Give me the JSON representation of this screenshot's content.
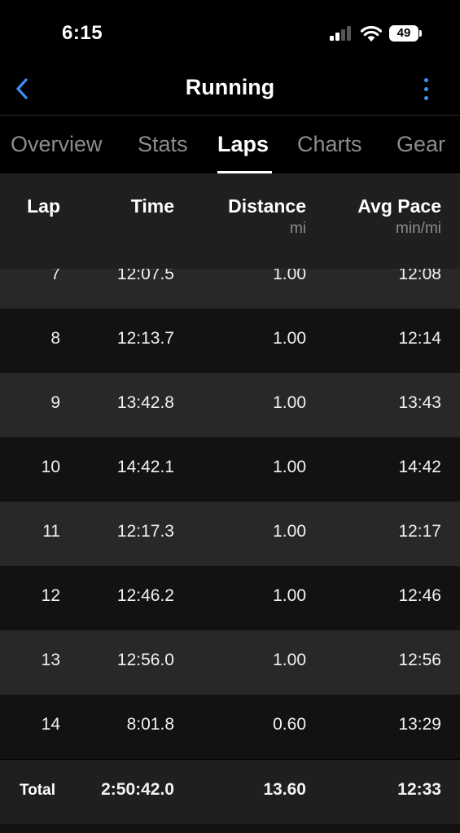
{
  "status_bar": {
    "time": "6:15",
    "battery": "49"
  },
  "nav": {
    "title": "Running",
    "back_icon": "chevron-left-icon",
    "menu_icon": "vertical-ellipsis-icon"
  },
  "tabs": [
    {
      "label": "Overview",
      "active": false
    },
    {
      "label": "Stats",
      "active": false
    },
    {
      "label": "Laps",
      "active": true
    },
    {
      "label": "Charts",
      "active": false
    },
    {
      "label": "Gear",
      "active": false
    }
  ],
  "table": {
    "columns": [
      {
        "label": "Lap",
        "unit": ""
      },
      {
        "label": "Time",
        "unit": ""
      },
      {
        "label": "Distance",
        "unit": "mi"
      },
      {
        "label": "Avg Pace",
        "unit": "min/mi"
      }
    ],
    "rows": [
      {
        "lap": "7",
        "time": "12:07.5",
        "distance": "1.00",
        "pace": "12:08"
      },
      {
        "lap": "8",
        "time": "12:13.7",
        "distance": "1.00",
        "pace": "12:14"
      },
      {
        "lap": "9",
        "time": "13:42.8",
        "distance": "1.00",
        "pace": "13:43"
      },
      {
        "lap": "10",
        "time": "14:42.1",
        "distance": "1.00",
        "pace": "14:42"
      },
      {
        "lap": "11",
        "time": "12:17.3",
        "distance": "1.00",
        "pace": "12:17"
      },
      {
        "lap": "12",
        "time": "12:46.2",
        "distance": "1.00",
        "pace": "12:46"
      },
      {
        "lap": "13",
        "time": "12:56.0",
        "distance": "1.00",
        "pace": "12:56"
      },
      {
        "lap": "14",
        "time": "8:01.8",
        "distance": "0.60",
        "pace": "13:29"
      }
    ],
    "total": {
      "label": "Total",
      "time": "2:50:42.0",
      "distance": "13.60",
      "pace": "12:33"
    }
  },
  "colors": {
    "accent": "#3b8ff5",
    "background": "#000000",
    "row_light": "#282828",
    "row_dark": "#121212",
    "muted_text": "#8c8c8c"
  }
}
